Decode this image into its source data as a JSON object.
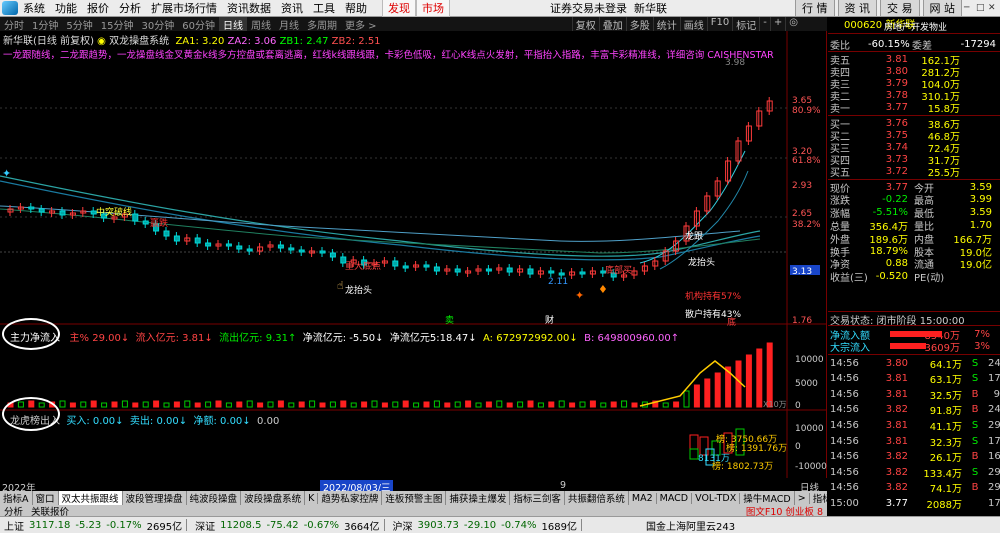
{
  "menu": {
    "items": [
      "系统",
      "功能",
      "报价",
      "分析",
      "扩展市场行情",
      "资讯数据",
      "资讯",
      "工具",
      "帮助"
    ],
    "discover": "发现",
    "market": "市场",
    "status": "证券交易未登录",
    "stock": "新华联",
    "right_buttons": [
      "行 情",
      "资 讯",
      "交 易",
      "网 站"
    ]
  },
  "periods": [
    "分时",
    "1分钟",
    "5分钟",
    "15分钟",
    "30分钟",
    "60分钟",
    "日线",
    "周线",
    "月线",
    "多周期",
    "更多 >"
  ],
  "active_period": "日线",
  "toolbar": [
    "复权",
    "叠加",
    "多股",
    "统计",
    "画线",
    "F10",
    "标记",
    "-",
    "+",
    "◎"
  ],
  "chart_header": {
    "name": "新华联(日线 前复权)",
    "system": "双龙操盘系统",
    "za1": "ZA1: 3.20",
    "za2": "ZA2: 3.06",
    "zb1": "ZB1: 2.47",
    "zb2": "ZB2: 2.51",
    "banner": "一龙跟随线，二龙跟趋势，一龙操盘线金叉黄金k线多方控盘或套离逃离，红线k线跟线跟，卡彩色低吸，红心K线点火发射，平指抬入指路，丰富卡彩精准线，详细咨询 CAISHENSTAR"
  },
  "price_axis": [
    "3.98",
    "3.65",
    "80.9%",
    "3.20",
    "61.8%",
    "2.93",
    "2.65",
    "38.2%",
    "1.76"
  ],
  "chart_annotations": {
    "label_1": "中突破线",
    "label_2": "赢跌",
    "label_3": "重大底点",
    "label_4": "龙抬头",
    "label_5": "卖",
    "label_6": "财",
    "label_7": "2.11",
    "label_8": "底部买",
    "label_9": "龙跟",
    "label_10": "龙抬头",
    "label_11": "机构持有57%",
    "label_12": "散户持有43%",
    "label_13": "底",
    "current_price_tag": "3.13"
  },
  "indicator1": {
    "name": "主力净流入",
    "fields": [
      "主% 29.00↓",
      "流入亿元: 3.81↓",
      "流出亿元: 9.31↑",
      "净流亿元: -5.50↓",
      "净流亿元5:18.47↓",
      "A: 672972992.00↓",
      "B: 649800960.00↑"
    ],
    "axis": [
      "10000",
      "5000",
      "0",
      "X10万"
    ]
  },
  "indicator2": {
    "name": "龙虎榜出入",
    "fields": [
      "买入: 0.00↓",
      "卖出: 0.00↓",
      "净额: 0.00↓",
      "0.00"
    ],
    "axis": [
      "10000",
      "0",
      "-10000"
    ],
    "label_buy": "榜: 3750.66万",
    "label_sell": "榜: 1391.76万",
    "label_c": "8131万",
    "label_d": "榜: 1802.73万"
  },
  "time_axis": {
    "year": "2022年",
    "date_highlight": "2022/08/03/三",
    "tick_9": "9",
    "tick_day": "日线"
  },
  "tabs": [
    "指标A",
    "窗口",
    "双太共振跟线",
    "波段管理操盘",
    "纯波段操盘",
    "波段操盘系统",
    "K",
    "趋势私家控牌",
    "连板预警主图",
    "捕获操主爆发",
    "指标三剑客",
    "共振翻倍系统",
    "MA2",
    "MACD",
    "VOL-TDX",
    "操牛MACD",
    ">",
    "指标B",
    "模",
    "板"
  ],
  "selected_tab": "双太共振跟线",
  "tabs2": {
    "left": [
      "分析",
      "关联报价"
    ],
    "right": "图文F10 创业板 8"
  },
  "statusbar": {
    "sh": "上证",
    "sh_val": "3117.18",
    "sh_chg": "-5.23",
    "sh_pct": "-0.17%",
    "sh_amt": "2695亿",
    "sz": "深证",
    "sz_val": "11208.5",
    "sz_chg": "-75.42",
    "sz_pct": "-0.67%",
    "sz_amt": "3664亿",
    "hs": "沪深",
    "hs_val": "3903.73",
    "hs_chg": "-29.10",
    "hs_pct": "-0.74%",
    "hs_amt": "1689亿",
    "server": "国金上海阿里云243"
  },
  "panel": {
    "code": "000620",
    "name": "新华联",
    "industry": "房地产开发物业",
    "webi_label": "委比",
    "webi": "-60.15%",
    "weicha_label": "委差",
    "weicha": "-17294",
    "asks": [
      {
        "l": "卖五",
        "p": "3.81",
        "v": "162.1万",
        "x": ""
      },
      {
        "l": "卖四",
        "p": "3.80",
        "v": "281.2万",
        "x": ""
      },
      {
        "l": "卖三",
        "p": "3.79",
        "v": "104.0万",
        "x": ""
      },
      {
        "l": "卖二",
        "p": "3.78",
        "v": "310.1万",
        "x": ""
      },
      {
        "l": "卖一",
        "p": "3.77",
        "v": "15.8万",
        "x": ""
      }
    ],
    "bids": [
      {
        "l": "买一",
        "p": "3.76",
        "v": "38.6万",
        "x": ""
      },
      {
        "l": "买二",
        "p": "3.75",
        "v": "46.8万",
        "x": ""
      },
      {
        "l": "买三",
        "p": "3.74",
        "v": "72.4万",
        "x": ""
      },
      {
        "l": "买四",
        "p": "3.73",
        "v": "31.7万",
        "x": ""
      },
      {
        "l": "买五",
        "p": "3.72",
        "v": "25.5万",
        "x": ""
      }
    ],
    "stats": [
      {
        "a": "现价",
        "av": "3.77",
        "b": "今开",
        "bv": "3.59"
      },
      {
        "a": "涨跌",
        "av": "-0.22",
        "b": "最高",
        "bv": "3.99"
      },
      {
        "a": "涨幅",
        "av": "-5.51%",
        "b": "最低",
        "bv": "3.59"
      },
      {
        "a": "总量",
        "av": "356.4万",
        "b": "量比",
        "bv": "1.70"
      },
      {
        "a": "外盘",
        "av": "189.6万",
        "b": "内盘",
        "bv": "166.7万"
      },
      {
        "a": "换手",
        "av": "18.79%",
        "b": "股本",
        "bv": "19.0亿"
      },
      {
        "a": "净资",
        "av": "0.88",
        "b": "流通",
        "bv": "19.0亿"
      },
      {
        "a": "收益(三)",
        "av": "-0.520",
        "b": "PE(动)",
        "bv": ""
      }
    ],
    "trade_state": "交易状态: 闭市阶段 15:00:00",
    "flow": [
      {
        "l": "净流入额",
        "v": "8540万",
        "pct": "7%"
      },
      {
        "l": "大宗流入",
        "v": "3609万",
        "pct": "3%"
      }
    ],
    "ticks": [
      {
        "t": "14:56",
        "p": "3.80",
        "v": "64.1万",
        "s": "S",
        "n": "24"
      },
      {
        "t": "14:56",
        "p": "3.81",
        "v": "63.1万",
        "s": "S",
        "n": "17"
      },
      {
        "t": "14:56",
        "p": "3.81",
        "v": "32.5万",
        "s": "B",
        "n": "9"
      },
      {
        "t": "14:56",
        "p": "3.82",
        "v": "91.8万",
        "s": "B",
        "n": "24"
      },
      {
        "t": "14:56",
        "p": "3.81",
        "v": "41.1万",
        "s": "S",
        "n": "29"
      },
      {
        "t": "14:56",
        "p": "3.81",
        "v": "32.3万",
        "s": "S",
        "n": "17"
      },
      {
        "t": "14:56",
        "p": "3.82",
        "v": "26.1万",
        "s": "B",
        "n": "16"
      },
      {
        "t": "14:56",
        "p": "3.82",
        "v": "133.4万",
        "s": "S",
        "n": "29"
      },
      {
        "t": "14:56",
        "p": "3.82",
        "v": "74.1万",
        "s": "B",
        "n": "29"
      },
      {
        "t": "15:00",
        "p": "3.77",
        "v": "2088万",
        "s": "",
        "n": "1795"
      }
    ]
  }
}
